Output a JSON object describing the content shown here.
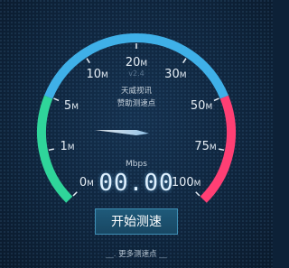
{
  "gauge": {
    "ticks": [
      {
        "value": "0",
        "unit": "M"
      },
      {
        "value": "1",
        "unit": "M"
      },
      {
        "value": "5",
        "unit": "M"
      },
      {
        "value": "10",
        "unit": "M"
      },
      {
        "value": "20",
        "unit": "M"
      },
      {
        "value": "30",
        "unit": "M"
      },
      {
        "value": "50",
        "unit": "M"
      },
      {
        "value": "75",
        "unit": "M"
      },
      {
        "value": "100",
        "unit": "M"
      }
    ],
    "version": "v2.4",
    "sponsor_line1": "天威视讯",
    "sponsor_line2": "赞助测速点",
    "needle_level": 0.18,
    "colors": {
      "green": "#2fd59a",
      "blue": "#3fb0e8",
      "pink": "#ff3f74",
      "needle": "#cfe8ff"
    }
  },
  "readout": {
    "unit": "Mbps",
    "value": "00.00"
  },
  "actions": {
    "start_label": "开始测速",
    "more_link_label": "更多测速点"
  }
}
